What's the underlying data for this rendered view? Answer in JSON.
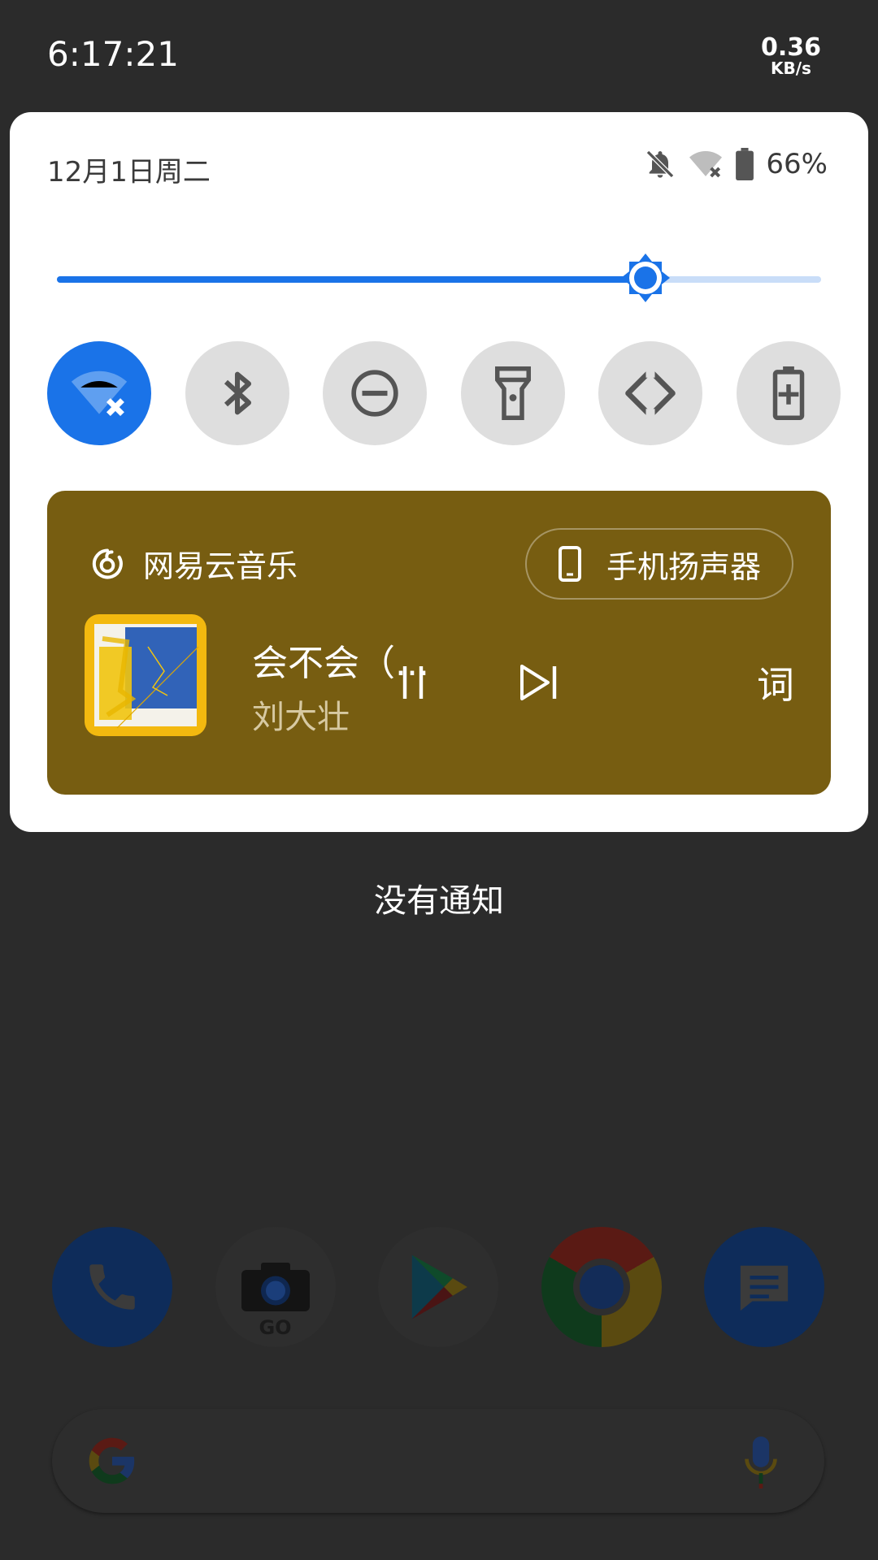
{
  "status_bar": {
    "time": "6:17:21",
    "net_speed_value": "0.36",
    "net_speed_unit": "KB/s"
  },
  "quick_settings": {
    "date": "12月1日周二",
    "battery_percent": "66%",
    "status_icons": [
      "bell-off-icon",
      "wifi-off-icon",
      "battery-icon"
    ],
    "brightness_level": 0.77,
    "tiles": [
      {
        "name": "wifi",
        "icon": "wifi-off-icon",
        "active": true
      },
      {
        "name": "bluetooth",
        "icon": "bluetooth-icon",
        "active": false
      },
      {
        "name": "do-not-disturb",
        "icon": "dnd-icon",
        "active": false
      },
      {
        "name": "flashlight",
        "icon": "flashlight-icon",
        "active": false
      },
      {
        "name": "auto-rotate",
        "icon": "rotate-icon",
        "active": false
      },
      {
        "name": "battery-saver",
        "icon": "battery-saver-icon",
        "active": false
      }
    ],
    "accent_color": "#1a73e8"
  },
  "media": {
    "app_name": "网易云音乐",
    "output_device": "手机扬声器",
    "song_title": "会不会（...",
    "artist": "刘大壮",
    "lyrics_button": "词",
    "card_color": "#775d11"
  },
  "notifications": {
    "empty_text": "没有通知"
  },
  "home": {
    "dock_apps": [
      "phone",
      "camera-go",
      "play-store",
      "chrome",
      "messages"
    ],
    "camera_label": "GO"
  }
}
